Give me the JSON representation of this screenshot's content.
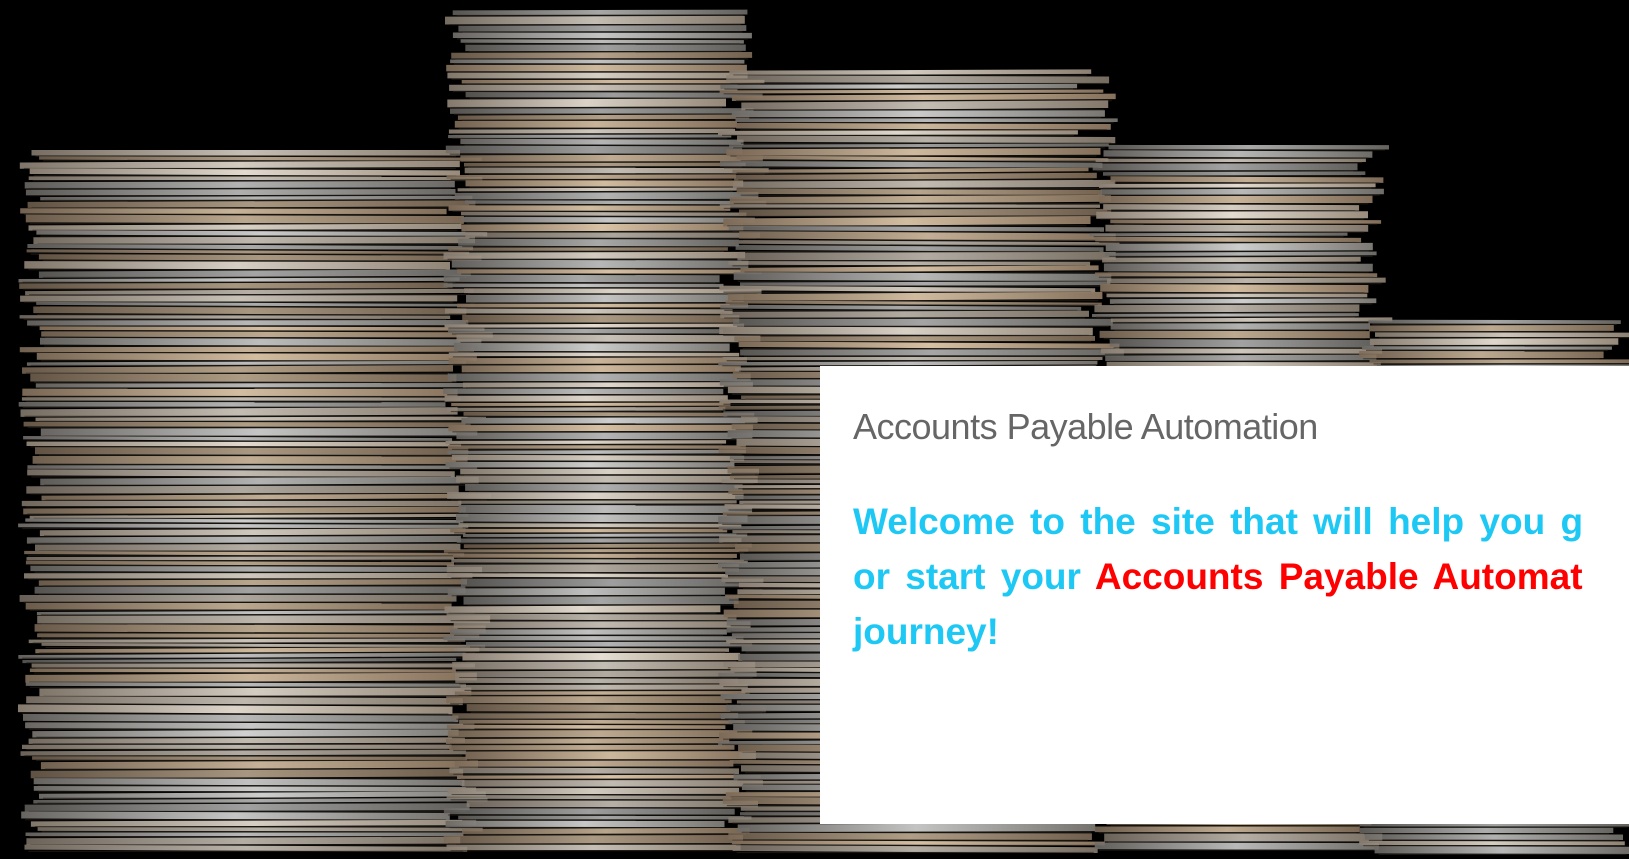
{
  "hero": {
    "image_description_icon": "paper-stacks-image",
    "background_color": "#000000"
  },
  "card": {
    "title": "Accounts Payable Automation",
    "welcome_part1": "Welcome to the site that will help you g",
    "welcome_part2": "or start your ",
    "welcome_highlight": "Accounts Payable Automat",
    "welcome_part3": "journey!",
    "colors": {
      "title": "#666666",
      "body": "#1ec8f4",
      "highlight": "#ff0000",
      "card_bg": "#ffffff"
    }
  }
}
